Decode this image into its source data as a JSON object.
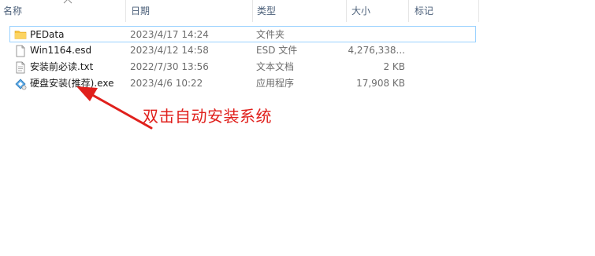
{
  "columns": {
    "name": "名称",
    "date": "日期",
    "type": "类型",
    "size": "大小",
    "tags": "标记"
  },
  "icons": {
    "sort": "chevron-up-icon",
    "folder": "folder-icon",
    "file": "document-icon",
    "setup": "installer-icon"
  },
  "colors": {
    "folder": "#f8c33b",
    "selection_border": "#99d1ff",
    "annotation": "#e0201c",
    "header_text": "#4c607a"
  },
  "files": [
    {
      "name": "PEData",
      "date": "2023/4/17 14:24",
      "type": "文件夹",
      "size": ""
    },
    {
      "name": "Win1164.esd",
      "date": "2023/4/12 14:58",
      "type": "ESD 文件",
      "size": "4,276,338..."
    },
    {
      "name": "安装前必读.txt",
      "date": "2022/7/30 13:56",
      "type": "文本文档",
      "size": "2 KB"
    },
    {
      "name": "硬盘安装(推荐).exe",
      "date": "2023/4/6 10:22",
      "type": "应用程序",
      "size": "17,908 KB"
    }
  ],
  "annotation": {
    "text": "双击自动安装系统"
  }
}
